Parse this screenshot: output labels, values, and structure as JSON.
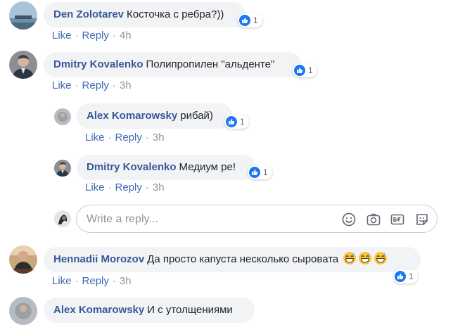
{
  "actions": {
    "like": "Like",
    "reply": "Reply",
    "dot": "·"
  },
  "colors": {
    "name": "#385898",
    "link": "#4267b2",
    "meta": "#90949c",
    "bubble": "#f2f3f5",
    "like_badge": "#1877f2"
  },
  "comments": [
    {
      "author": "Den Zolotarev",
      "text": "Косточка с ребра?))",
      "time": "4h",
      "reactions": "1",
      "avatar_icon": "landscape-avatar-icon"
    },
    {
      "author": "Dmitry Kovalenko",
      "text": "Полипропилен \"альденте\"",
      "time": "3h",
      "reactions": "1",
      "avatar_icon": "man-suit-avatar-icon"
    },
    {
      "author": "Alex Komarowsky",
      "text": "рибай)",
      "time": "3h",
      "reactions": "1",
      "avatar_icon": "gray-avatar-icon"
    },
    {
      "author": "Dmitry Kovalenko",
      "text": "Медиум ре!",
      "time": "3h",
      "reactions": "1",
      "avatar_icon": "man-suit-avatar-icon"
    },
    {
      "author": "Hennadii Morozov",
      "text": "Да просто капуста несколько сыровата",
      "emoji": [
        "grinning-sweat-emoji",
        "grinning-sweat-emoji",
        "grinning-sweat-emoji"
      ],
      "time": "3h",
      "reactions": "1",
      "avatar_icon": "man-desk-avatar-icon"
    },
    {
      "author": "Alex Komarowsky",
      "text": "И с утолщениями",
      "avatar_icon": "gray-avatar-icon"
    }
  ],
  "reply_box": {
    "placeholder": "Write a reply...",
    "icons": [
      "emoji-icon",
      "camera-icon",
      "gif-icon",
      "sticker-icon"
    ]
  }
}
